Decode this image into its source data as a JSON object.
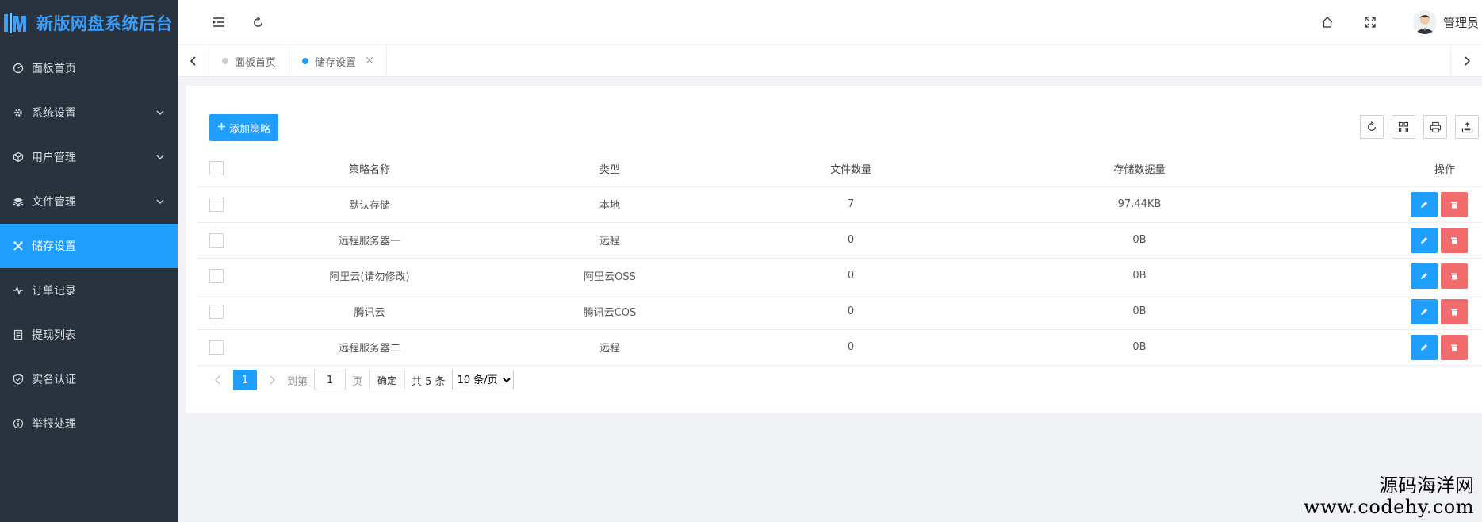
{
  "app": {
    "title": "新版网盘系统后台",
    "accent": "#1e9fff",
    "sidebar_bg": "#28333e"
  },
  "sidebar": {
    "items": [
      {
        "label": "面板首页",
        "icon": "dashboard-icon",
        "expandable": false,
        "active": false
      },
      {
        "label": "系统设置",
        "icon": "gear-icon",
        "expandable": true,
        "active": false
      },
      {
        "label": "用户管理",
        "icon": "cube-icon",
        "expandable": true,
        "active": false
      },
      {
        "label": "文件管理",
        "icon": "layers-icon",
        "expandable": true,
        "active": false
      },
      {
        "label": "储存设置",
        "icon": "tools-icon",
        "expandable": false,
        "active": true
      },
      {
        "label": "订单记录",
        "icon": "pulse-icon",
        "expandable": false,
        "active": false
      },
      {
        "label": "提现列表",
        "icon": "clipboard-icon",
        "expandable": false,
        "active": false
      },
      {
        "label": "实名认证",
        "icon": "shield-check-icon",
        "expandable": false,
        "active": false
      },
      {
        "label": "举报处理",
        "icon": "info-circle-icon",
        "expandable": false,
        "active": false
      }
    ]
  },
  "header": {
    "username": "管理员"
  },
  "tabs": [
    {
      "label": "面板首页",
      "active": false,
      "closable": false
    },
    {
      "label": "储存设置",
      "active": true,
      "closable": true
    }
  ],
  "toolbar": {
    "add_label": "添加策略",
    "add_icon": "plus-icon"
  },
  "table": {
    "columns": [
      "策略名称",
      "类型",
      "文件数量",
      "存储数据量",
      "操作"
    ],
    "rows": [
      {
        "name": "默认存储",
        "type": "本地",
        "count": "7",
        "size": "97.44KB"
      },
      {
        "name": "远程服务器一",
        "type": "远程",
        "count": "0",
        "size": "0B"
      },
      {
        "name": "阿里云(请勿修改)",
        "type": "阿里云OSS",
        "count": "0",
        "size": "0B"
      },
      {
        "name": "腾讯云",
        "type": "腾讯云COS",
        "count": "0",
        "size": "0B"
      },
      {
        "name": "远程服务器二",
        "type": "远程",
        "count": "0",
        "size": "0B"
      }
    ]
  },
  "pager": {
    "current": "1",
    "goto_prefix": "到第",
    "goto_value": "1",
    "goto_suffix": "页",
    "confirm": "确定",
    "total": "共 5 条",
    "page_size": "10 条/页"
  },
  "watermark": {
    "line1": "源码海洋网",
    "line2": "www.codehy.com"
  }
}
